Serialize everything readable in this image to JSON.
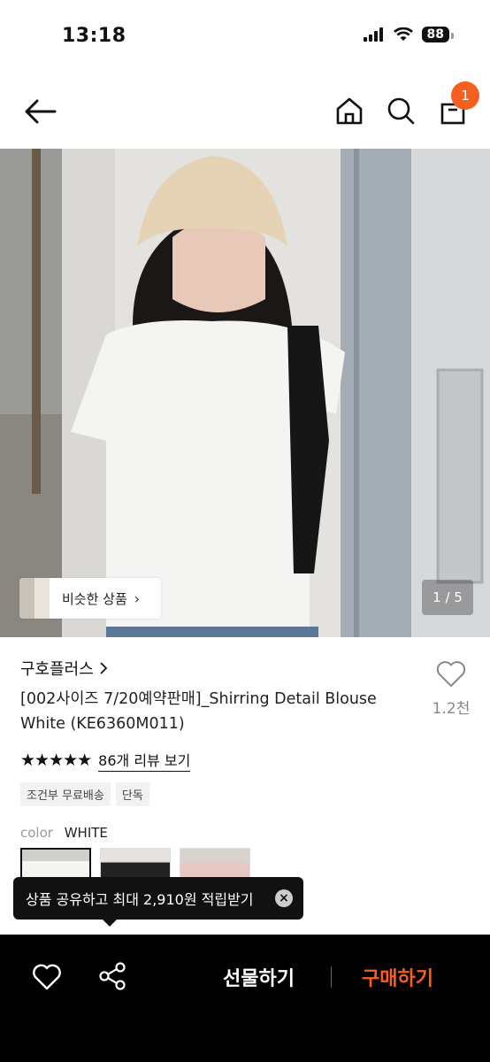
{
  "status_bar": {
    "time": "13:18",
    "battery": "88"
  },
  "nav": {
    "cart_count": "1"
  },
  "hero": {
    "similar_label": "비슷한 상품",
    "pager": "1 / 5"
  },
  "product": {
    "brand": "구호플러스",
    "title": "[002사이즈 7/20예약판매]_Shirring Detail Blouse White (KE6360M011)",
    "wish_count": "1.2천",
    "stars": "★★★★★",
    "review_link": "86개 리뷰 보기",
    "tags": [
      "조건부 무료배송",
      "단독"
    ],
    "color_label": "color",
    "color_value": "WHITE"
  },
  "toast": {
    "text": "상품 공유하고 최대 2,910원 적립받기"
  },
  "bottom_bar": {
    "gift_label": "선물하기",
    "buy_label": "구매하기"
  },
  "colors": {
    "accent": "#f5601e"
  }
}
